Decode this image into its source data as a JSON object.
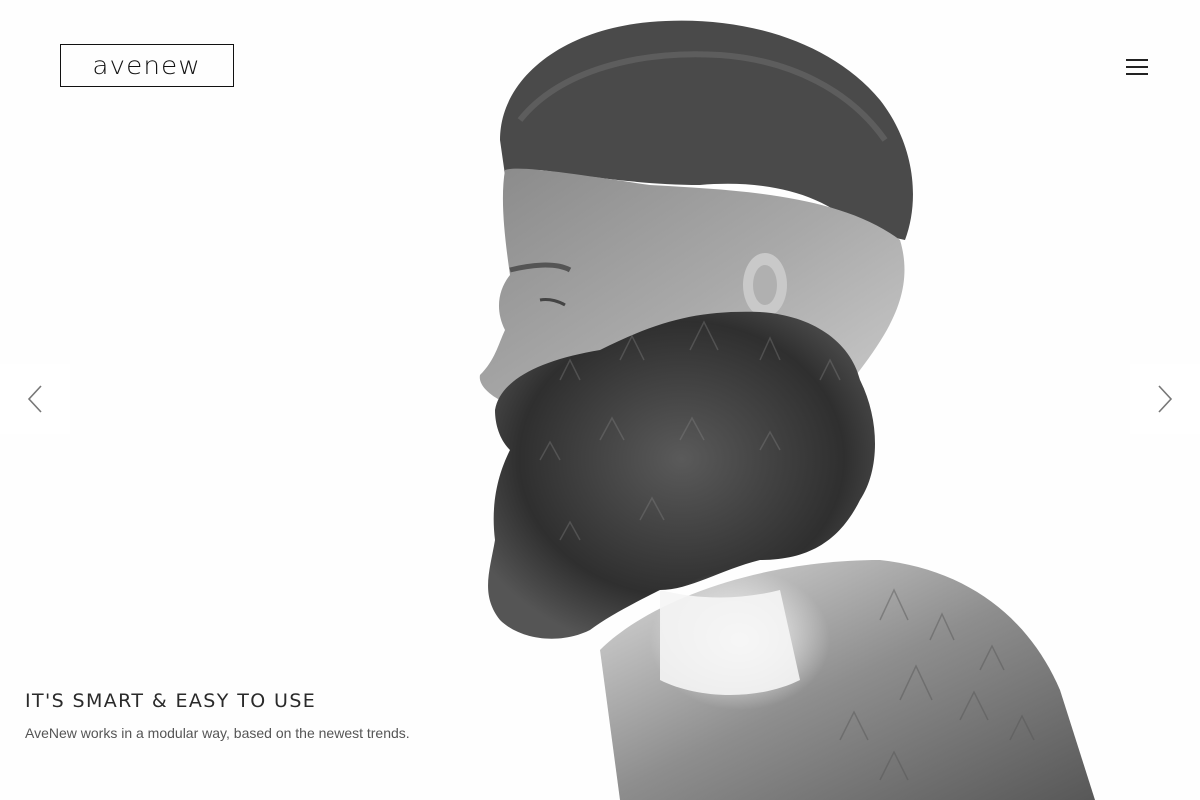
{
  "header": {
    "logo_text": "avenew",
    "menu_icon": "hamburger-icon"
  },
  "slider": {
    "prev_icon": "chevron-left-icon",
    "next_icon": "chevron-right-icon",
    "slide": {
      "title": "IT'S SMART & EASY TO USE",
      "text": "AveNew works in a modular way, based on the newest trends."
    }
  },
  "colors": {
    "background": "#fefefe",
    "text_dark": "#2a2a2a",
    "text_muted": "#555555"
  }
}
